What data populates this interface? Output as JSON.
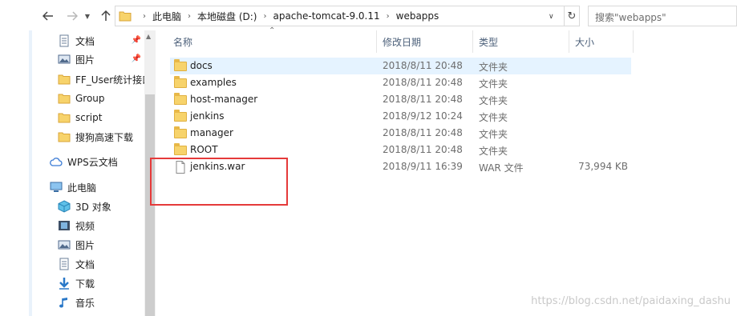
{
  "address": {
    "crumbs": [
      "此电脑",
      "本地磁盘 (D:)",
      "apache-tomcat-9.0.11",
      "webapps"
    ]
  },
  "search": {
    "placeholder": "搜索\"webapps\""
  },
  "sidebar": {
    "items": [
      {
        "label": "文档",
        "icon": "document-icon",
        "pinned": true
      },
      {
        "label": "图片",
        "icon": "picture-icon",
        "pinned": true
      },
      {
        "label": "FF_User统计接口",
        "icon": "folder-icon",
        "pinned": false
      },
      {
        "label": "Group",
        "icon": "folder-icon",
        "pinned": false
      },
      {
        "label": "script",
        "icon": "folder-icon",
        "pinned": false
      },
      {
        "label": "搜狗高速下载",
        "icon": "folder-icon",
        "pinned": false
      },
      {
        "label": "WPS云文档",
        "icon": "cloud-icon",
        "pinned": false
      },
      {
        "label": "此电脑",
        "icon": "computer-icon",
        "pinned": false
      },
      {
        "label": "3D 对象",
        "icon": "cube-icon",
        "pinned": false
      },
      {
        "label": "视频",
        "icon": "video-icon",
        "pinned": false
      },
      {
        "label": "图片",
        "icon": "picture-icon",
        "pinned": false
      },
      {
        "label": "文档",
        "icon": "document-icon",
        "pinned": false
      },
      {
        "label": "下载",
        "icon": "download-icon",
        "pinned": false
      },
      {
        "label": "音乐",
        "icon": "music-icon",
        "pinned": false
      }
    ]
  },
  "columns": {
    "name": "名称",
    "date": "修改日期",
    "type": "类型",
    "size": "大小"
  },
  "files": [
    {
      "name": "docs",
      "date": "2018/8/11 20:48",
      "type": "文件夹",
      "size": "",
      "kind": "folder",
      "selected": true
    },
    {
      "name": "examples",
      "date": "2018/8/11 20:48",
      "type": "文件夹",
      "size": "",
      "kind": "folder",
      "selected": false
    },
    {
      "name": "host-manager",
      "date": "2018/8/11 20:48",
      "type": "文件夹",
      "size": "",
      "kind": "folder",
      "selected": false
    },
    {
      "name": "jenkins",
      "date": "2018/9/12 10:24",
      "type": "文件夹",
      "size": "",
      "kind": "folder",
      "selected": false
    },
    {
      "name": "manager",
      "date": "2018/8/11 20:48",
      "type": "文件夹",
      "size": "",
      "kind": "folder",
      "selected": false
    },
    {
      "name": "ROOT",
      "date": "2018/8/11 20:48",
      "type": "文件夹",
      "size": "",
      "kind": "folder",
      "selected": false
    },
    {
      "name": "jenkins.war",
      "date": "2018/9/11 16:39",
      "type": "WAR 文件",
      "size": "73,994 KB",
      "kind": "file",
      "selected": false
    }
  ],
  "watermark": "https://blog.csdn.net/paidaxing_dashu",
  "colors": {
    "selection": "#e5f3ff",
    "highlight_box": "#e53a3a",
    "folder": "#f7d36b",
    "header_text": "#4c607a"
  }
}
